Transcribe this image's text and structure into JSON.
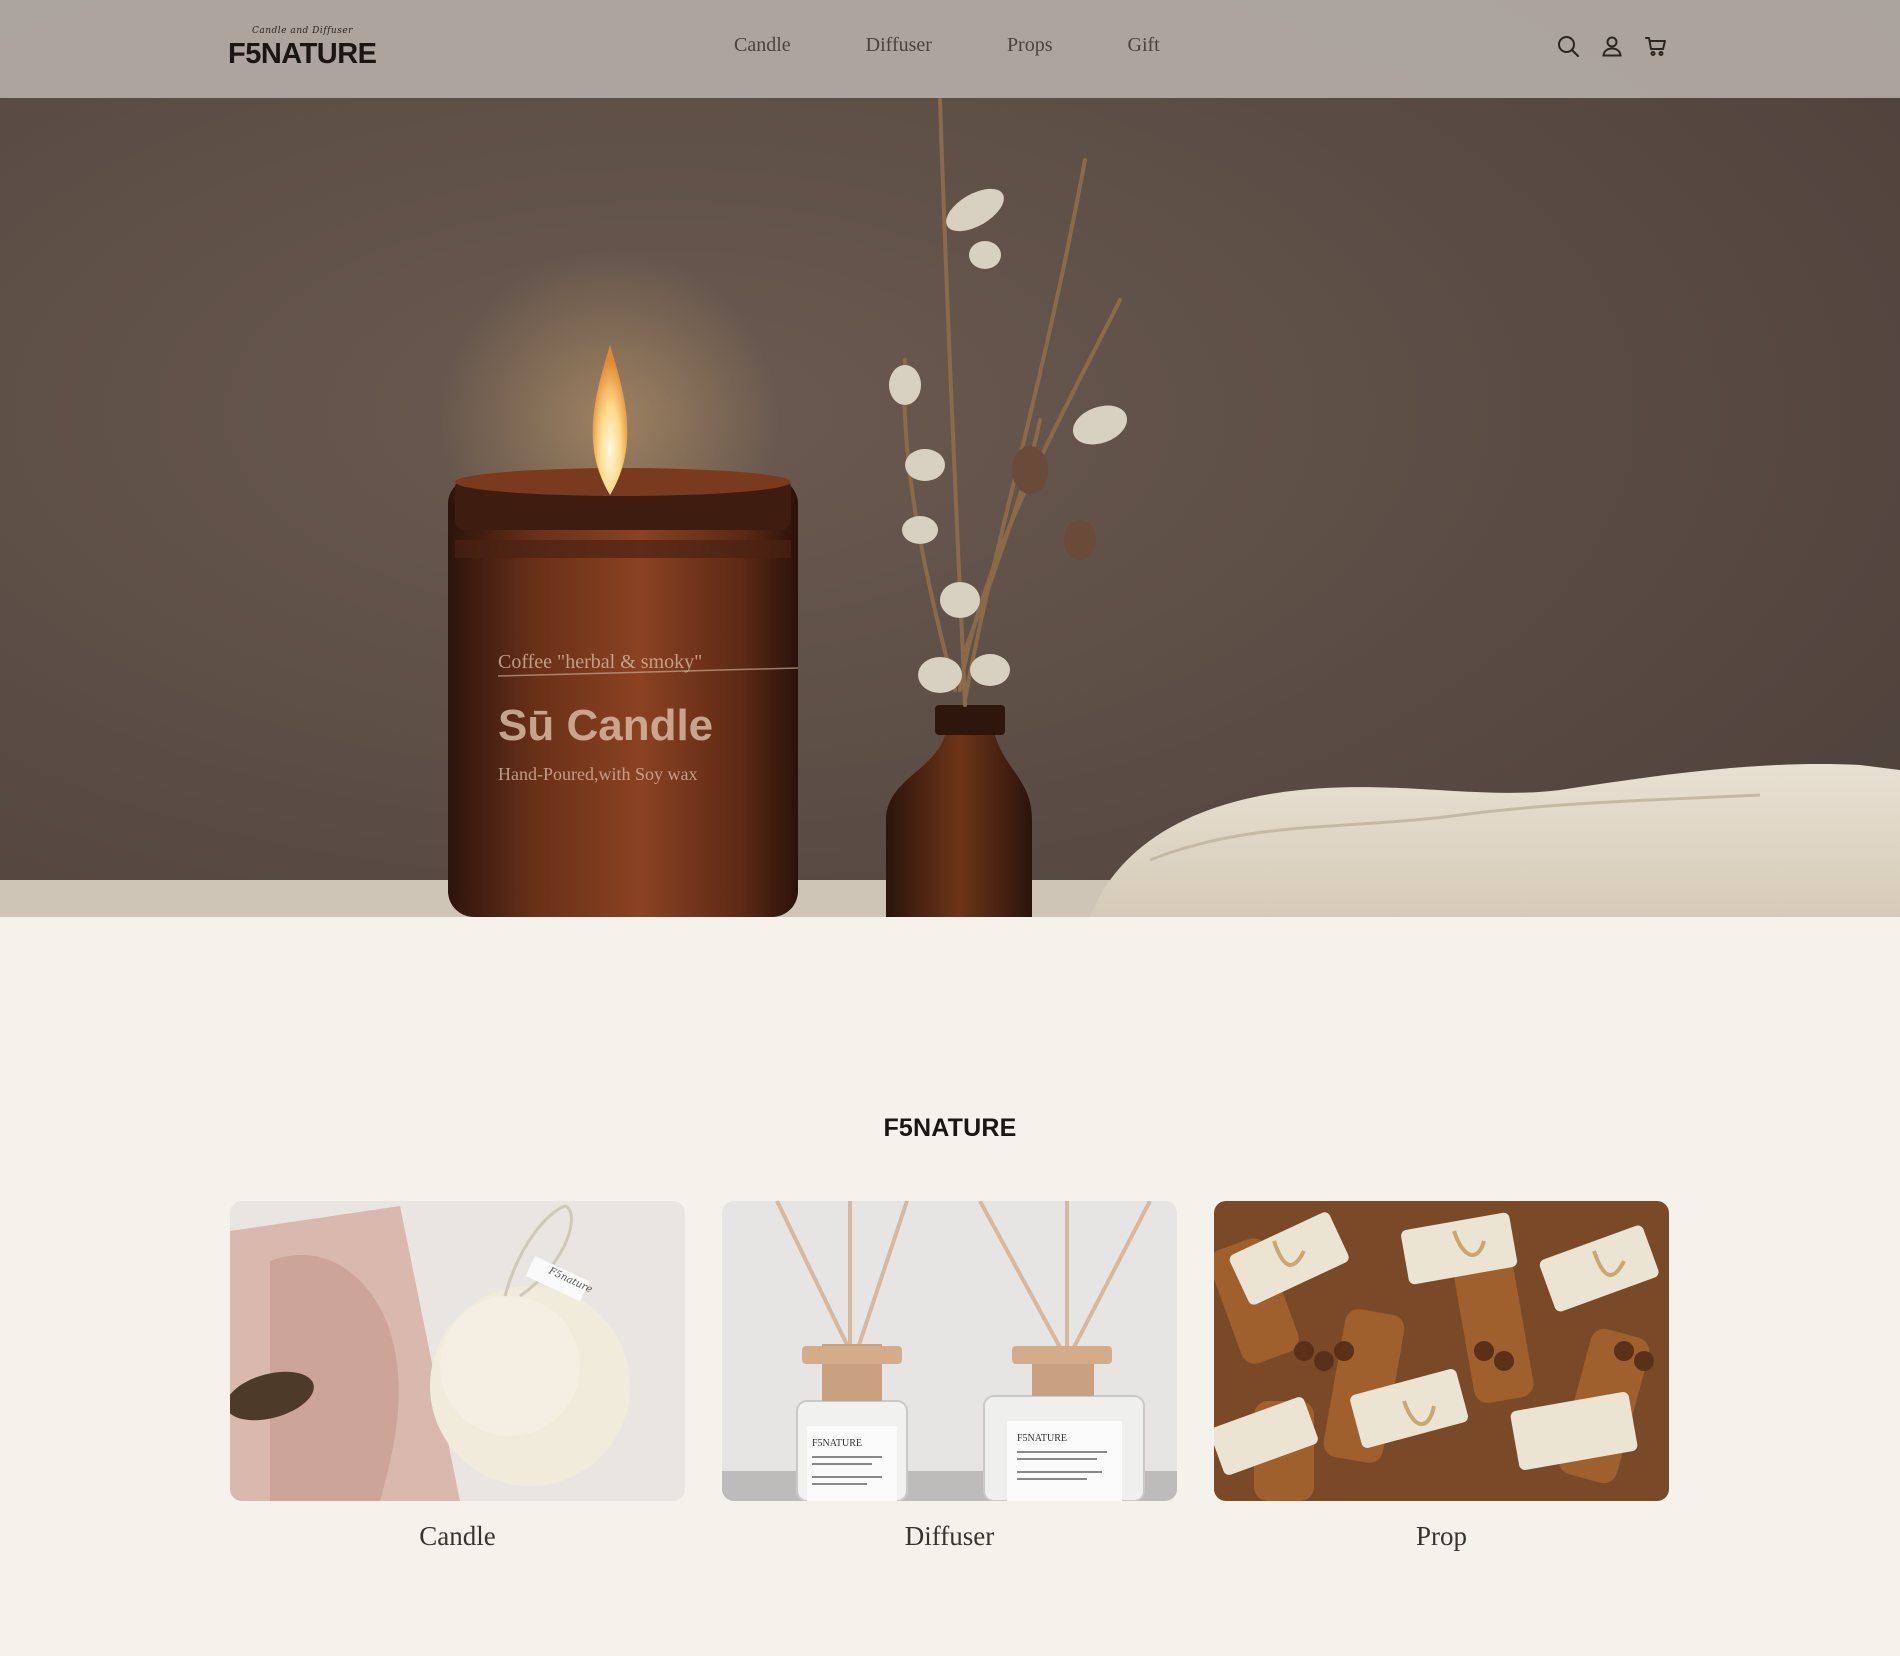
{
  "header": {
    "logo_script": "Candle and Diffuser",
    "logo_text": "F5NATURE",
    "nav": [
      "Candle",
      "Diffuser",
      "Props",
      "Gift"
    ],
    "icons": [
      "search-icon",
      "user-icon",
      "cart-icon"
    ]
  },
  "hero": {
    "jar_line1": "Coffee \"herbal & smoky\"",
    "jar_line2": "Sū Candle",
    "jar_line3": "Hand-Poured,with Soy wax"
  },
  "section": {
    "title": "F5NATURE",
    "cards": [
      {
        "label": "Candle",
        "tag": "F5nature"
      },
      {
        "label": "Diffuser",
        "bottle_brand": "F5NATURE"
      },
      {
        "label": "Prop"
      }
    ]
  },
  "colors": {
    "header_bg": "#b8b0ac",
    "page_bg": "#f5f1eb",
    "hero_wall": "#5e5048",
    "amber_glass": "#5a2a16"
  }
}
